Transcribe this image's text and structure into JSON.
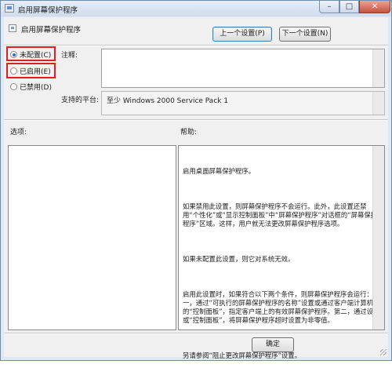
{
  "window": {
    "title": "启用屏幕保护程序",
    "minimize_glyph": "–",
    "maximize_glyph": "□",
    "close_glyph": "✕"
  },
  "header": {
    "policy_name": "启用屏幕保护程序",
    "prev_button": "上一个设置(P)",
    "next_button": "下一个设置(N)"
  },
  "state": {
    "options": [
      {
        "label": "未配置(C)",
        "checked": true
      },
      {
        "label": "已启用(E)",
        "checked": false
      },
      {
        "label": "已禁用(D)",
        "checked": false
      }
    ]
  },
  "comment": {
    "label": "注释:",
    "value": ""
  },
  "platform": {
    "label": "支持的平台:",
    "value": "至少 Windows 2000 Service Pack 1"
  },
  "options_panel": {
    "label": "选项:"
  },
  "help_panel": {
    "label": "帮助:",
    "paragraphs": [
      "启用桌面屏幕保护程序。",
      "如果禁用此设置，则屏幕保护程序不会运行。此外，此设置还禁用“个性化”或“显示控制面板”中“屏幕保护程序”对话框的“屏幕保护程序”区域。这样，用户就无法更改屏幕保护程序选项。",
      "如果未配置此设置，则它对系统无效。",
      "启用此设置时，如果符合以下两个条件，则屏幕保护程序会运行：第一，通过“可执行的屏幕保护程序的名称”设置或通过客户端计算机上的“控制面板”，指定客户端上的有效屏幕保护程序。第二，通过设置或“控制面板”，将屏幕保护程序超时设置为非零值。",
      "另请参阅“阻止更改屏幕保护程序”设置。"
    ]
  },
  "footer": {
    "ok_button": "确定"
  }
}
